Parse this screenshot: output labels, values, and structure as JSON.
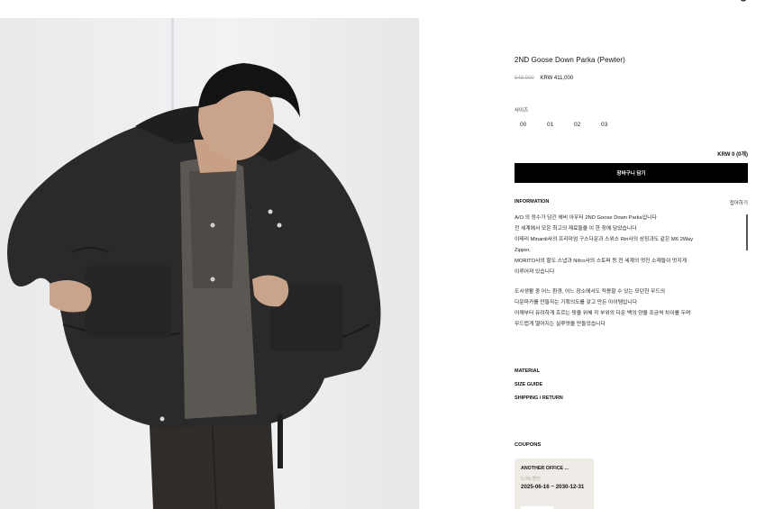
{
  "product": {
    "title": "2ND Goose Down Parka (Pewter)",
    "price_original": "548,000",
    "price_sale": "KRW 411,000"
  },
  "size": {
    "label": "사이즈",
    "options": [
      "00",
      "01",
      "02",
      "03"
    ]
  },
  "total": "KRW 0 (0개)",
  "cart_button": "장바구니 담기",
  "information": {
    "heading": "INFORMATION",
    "toggle": "접어하기",
    "lines": [
      "A/O.의 정수가 담긴 헤비 아우터 2ND Goose Down Parka입니다",
      "전 세계에서 모은 최고의 재료들을 이 한 장에 담았습니다",
      "이태리 Minardi사의 프리미엄 구스다운과 스위스 Riri사의 상징과도 같은 M6 2Way",
      "Zipper,",
      "MORITO사의 할도 스냅과 Nifco사의 스토퍼 등 전 세계의 멋진 소재들이 멋지게",
      "이루어져 있습니다",
      "",
      "도시생활 중 어느 환경, 어느 장소에서도 적용할 수 있는 모던한 무드의",
      "다운파카를 만들자는 기획의도를 갖고 만든 아이템입니다",
      "어깨부터 유려하게 흐르는 핏을 위해 각 부위의 다운 백의 양을 조금씩 차이를 두며",
      "무드럽게 떨어지는 실루엣을 만들었습니다"
    ]
  },
  "links": [
    "MATERIAL",
    "SIZE GUIDE",
    "SHIPPING / RETURN"
  ],
  "coupons": {
    "heading": "COUPONS",
    "items": [
      {
        "name": "ANOTHER OFFICE ...",
        "discount": "5.0% 할인",
        "period": "2025-06-16 ~ 2030-12-31"
      }
    ]
  },
  "colors": {
    "cart_button_bg": "#000000",
    "coupon_bg": "#efebe6",
    "old_price": "#aaaaaa"
  },
  "icons": [
    "user-icon"
  ]
}
